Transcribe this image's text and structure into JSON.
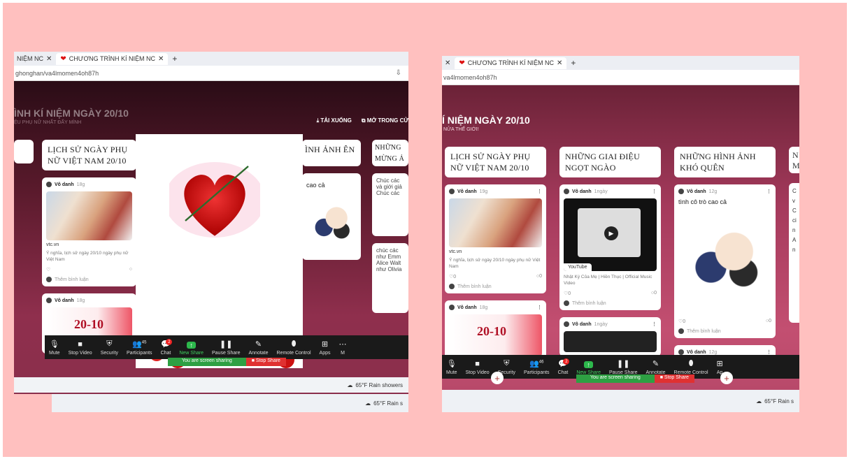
{
  "left": {
    "tabs": [
      "NIỆM NC",
      "CHƯƠNG TRÌNH KÍ NIỆM NC"
    ],
    "url": "ghonghan/va4lmomen4oh87h",
    "download": "TẢI XUỐNG",
    "open": "MỞ TRONG CỬ",
    "board_title": "ÌNH KÍ NIỆM NGÀY 20/10",
    "board_sub": "ỆU PHỤ NỮ NHẤT ĐẤY MÌNH",
    "columns": [
      "LỊCH SỬ NGÀY PHỤ NỮ VIỆT NAM 20/10",
      "ÌNH ẢNH ÊN",
      "NHỮNG MỪNG Ả"
    ],
    "author": "Vô danh",
    "time": "18g",
    "source": "vtc.vn",
    "caption": "Ý nghĩa, lịch sử ngày 20/10 ngày phụ nữ Việt Nam",
    "post_title": "cao cả",
    "side_text1": "Chúc các và giới giả Chúc các",
    "side_text2": "chúc các như Emm Alice Walt như Olivia",
    "comment": "Thêm bình luận",
    "zoom": {
      "participants": "45",
      "chat_badge": "2",
      "items": [
        "Mute",
        "Stop Video",
        "Security",
        "Participants",
        "Chat",
        "New Share",
        "Pause Share",
        "Annotate",
        "Remote Control",
        "Apps",
        "M"
      ],
      "sharing": "You are screen sharing",
      "stop": "Stop Share"
    },
    "weather": "65°F  Rain showers",
    "weather2": "65°F  Rain s",
    "banner_text": "20-10"
  },
  "right": {
    "tabs": [
      "CHƯƠNG TRÌNH KÍ NIỆM NC"
    ],
    "url": "va4lmomen4oh87h",
    "board_title": "Í NIỆM NGÀY 20/10",
    "board_sub": "NỬA THẾ GIỚI!",
    "columns": [
      "LỊCH SỬ NGÀY PHỤ NỮ VIỆT NAM 20/10",
      "NHỮNG GIAI ĐIỆU NGỌT NGÀO",
      "NHỮNG HÌNH ẢNH KHÓ QUÊN",
      "N M"
    ],
    "author": "Vô danh",
    "times": [
      "19g",
      "1ngày",
      "12g",
      "18g",
      "1ngày",
      "12g"
    ],
    "source": "vtc.vn",
    "caption": "Ý nghĩa, lịch sử ngày 20/10 ngày phụ nữ Việt Nam",
    "youtube": "YouTube",
    "video_title": "Nhật Ký Của Mẹ | Hiền Thục | Official Music Video",
    "post_title": "tình cô trò cao cả",
    "comment": "Thêm bình luận",
    "zero": "0",
    "side_text": "C v C ci n A n",
    "zoom": {
      "participants": "46",
      "chat_badge": "2",
      "items": [
        "Mute",
        "Stop Video",
        "Security",
        "Participants",
        "Chat",
        "New Share",
        "Pause Share",
        "Annotate",
        "Remote Control",
        "Ap"
      ],
      "sharing": "You are screen sharing",
      "stop": "Stop Share"
    },
    "weather": "65°F  Rain s",
    "banner_text": "20-10"
  }
}
